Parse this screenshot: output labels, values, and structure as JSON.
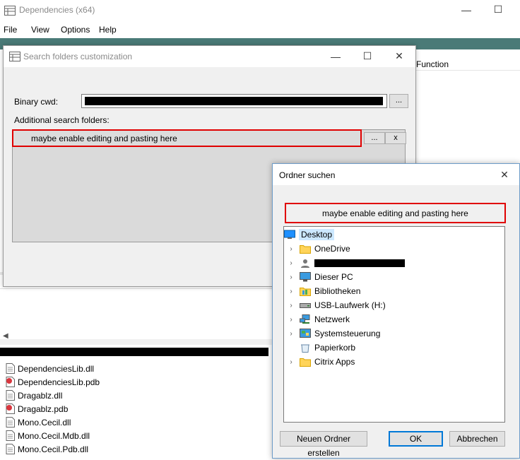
{
  "main_window": {
    "title": "Dependencies (x64)",
    "minimize": "—",
    "maximize": "☐",
    "menu": [
      "File",
      "View",
      "Options",
      "Help"
    ],
    "column_function": "Function",
    "files": [
      {
        "name": "DependenciesLib.dll",
        "icon": "dll"
      },
      {
        "name": "DependenciesLib.pdb",
        "icon": "pdb"
      },
      {
        "name": "Dragablz.dll",
        "icon": "dll"
      },
      {
        "name": "Dragablz.pdb",
        "icon": "pdb"
      },
      {
        "name": "Mono.Cecil.dll",
        "icon": "dll"
      },
      {
        "name": "Mono.Cecil.Mdb.dll",
        "icon": "dll"
      },
      {
        "name": "Mono.Cecil.Pdb.dll",
        "icon": "dll"
      }
    ]
  },
  "search_dialog": {
    "title": "Search folders customization",
    "minimize": "—",
    "maximize": "☐",
    "close": "✕",
    "binary_cwd_label": "Binary cwd:",
    "browse_label": "...",
    "additional_label": "Additional search folders:",
    "annotation": "maybe enable editing and pasting here",
    "add_label": "...",
    "remove_label": "x"
  },
  "folder_dialog": {
    "title": "Ordner suchen",
    "close": "✕",
    "annotation": "maybe enable editing and pasting here",
    "tree": [
      {
        "label": "Desktop",
        "icon": "desktop-icon",
        "chevron": "",
        "selected": true
      },
      {
        "label": "OneDrive",
        "icon": "folder-icon",
        "chevron": "›",
        "selected": false
      },
      {
        "label": "",
        "icon": "user-icon",
        "chevron": "›",
        "selected": false,
        "redacted": true
      },
      {
        "label": "Dieser PC",
        "icon": "computer-icon",
        "chevron": "›",
        "selected": false
      },
      {
        "label": "Bibliotheken",
        "icon": "library-icon",
        "chevron": "›",
        "selected": false
      },
      {
        "label": "USB-Laufwerk (H:)",
        "icon": "drive-icon",
        "chevron": "›",
        "selected": false
      },
      {
        "label": "Netzwerk",
        "icon": "network-icon",
        "chevron": "›",
        "selected": false
      },
      {
        "label": "Systemsteuerung",
        "icon": "control-panel-icon",
        "chevron": "›",
        "selected": false
      },
      {
        "label": "Papierkorb",
        "icon": "recycle-bin-icon",
        "chevron": "",
        "selected": false
      },
      {
        "label": "Citrix Apps",
        "icon": "folder-icon",
        "chevron": "›",
        "selected": false
      }
    ],
    "new_folder_label": "Neuen Ordner erstellen",
    "ok_label": "OK",
    "cancel_label": "Abbrechen"
  },
  "colors": {
    "annotation_red": "#e00000",
    "selection": "#cce8ff",
    "toolbar": "#4a7a77",
    "default_button_border": "#0078d7"
  }
}
